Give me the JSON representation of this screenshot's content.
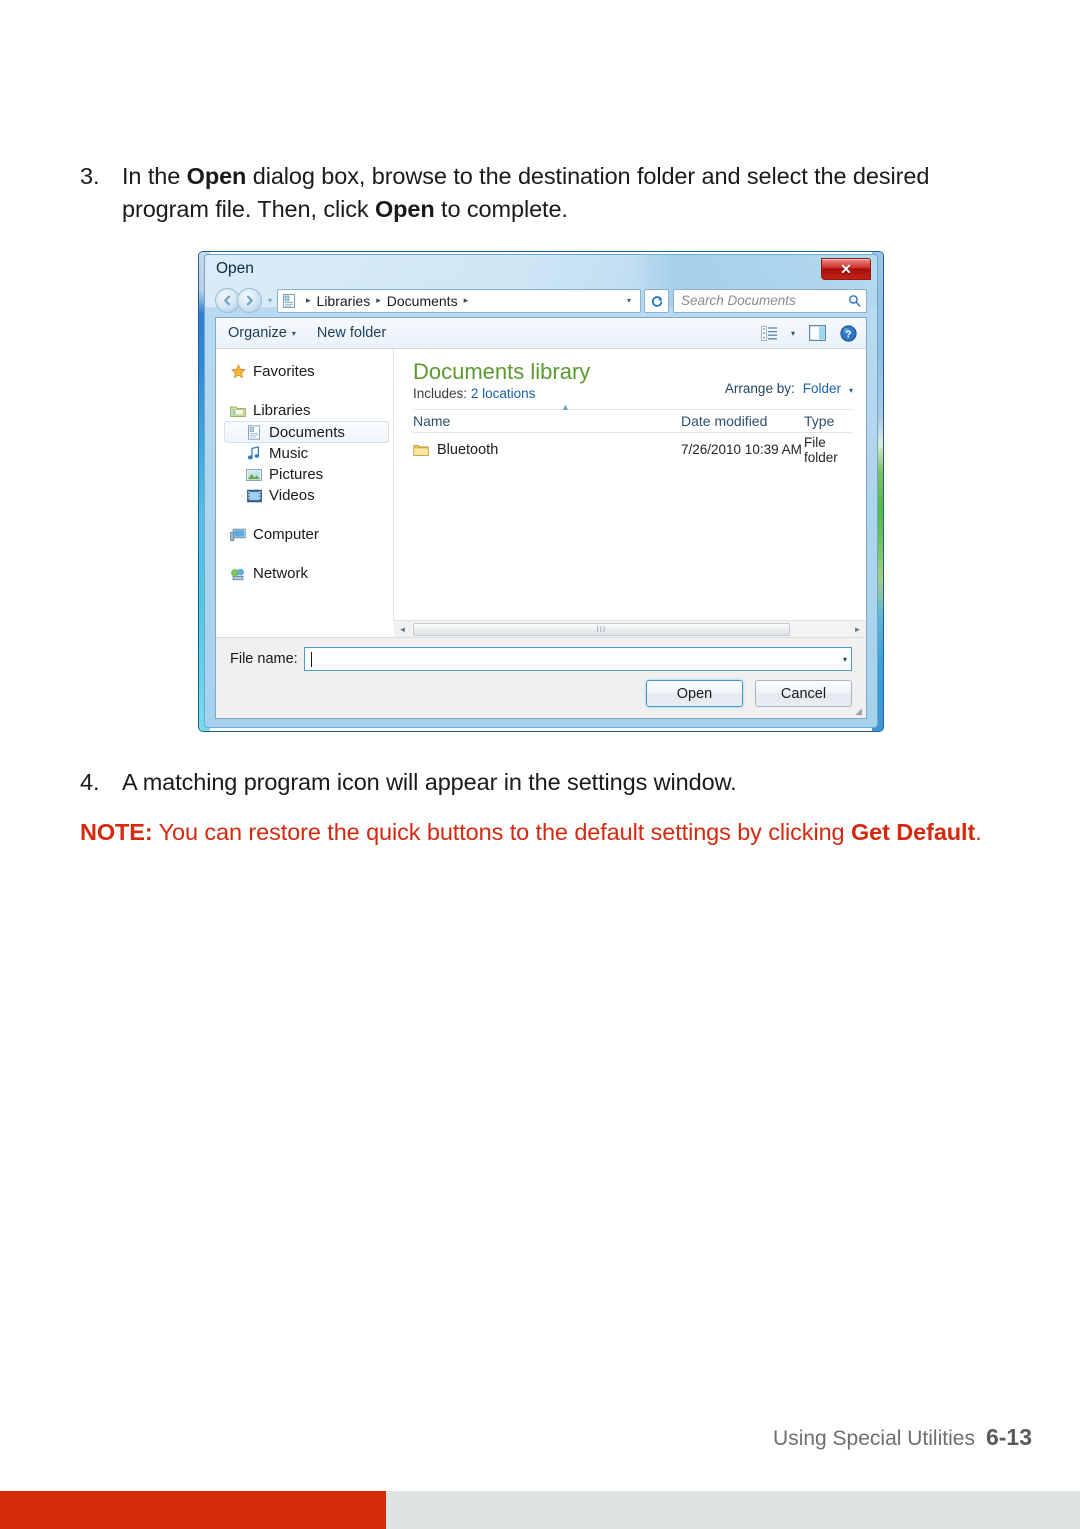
{
  "document": {
    "steps": [
      {
        "number": "3.",
        "parts": [
          {
            "text": "In the ",
            "bold": false
          },
          {
            "text": "Open",
            "bold": true
          },
          {
            "text": " dialog box, browse to the destination folder and select the desired program file. Then, click ",
            "bold": false
          },
          {
            "text": "Open",
            "bold": true
          },
          {
            "text": " to complete.",
            "bold": false
          }
        ],
        "plain": "In the Open dialog box, browse to the destination folder and select the desired program file. Then, click Open to complete."
      },
      {
        "number": "4.",
        "parts": [
          {
            "text": "A matching program icon will appear in the settings window.",
            "bold": false
          }
        ],
        "plain": "A matching program icon will appear in the settings window."
      }
    ],
    "note": {
      "label": "NOTE:",
      "text": " You can restore the quick buttons to the default settings by clicking ",
      "emphasis": "Get Default",
      "period": ".",
      "color": "#d4290f"
    },
    "footer": {
      "chapter_title": "Using Special Utilities",
      "page_number": "6-13"
    },
    "bottom_bar": {
      "accent_color": "#d42a08",
      "neutral_color": "#dde3e3"
    }
  },
  "dialog": {
    "title": "Open",
    "close_button": "✕",
    "navigation": {
      "back_icon": "back-arrow-icon",
      "forward_icon": "forward-arrow-icon",
      "history_caret": "▾",
      "address_icon": "documents-library-icon",
      "breadcrumbs": [
        "Libraries",
        "Documents"
      ],
      "breadcrumb_separator": "▸",
      "address_dropdown": "▾",
      "refresh_icon": "↻",
      "search_placeholder": "Search Documents",
      "search_icon": "search-icon"
    },
    "toolbar": {
      "organize_label": "Organize",
      "organize_caret": "▾",
      "new_folder_label": "New folder",
      "view_icon": "view-list-icon",
      "view_caret": "▾",
      "preview_pane_icon": "preview-pane-icon",
      "help_icon": "help-icon"
    },
    "nav_pane": [
      {
        "label": "Favorites",
        "icon": "star-icon",
        "indent": false,
        "selected": false,
        "gap_after": true
      },
      {
        "label": "Libraries",
        "icon": "libraries-icon",
        "indent": false,
        "selected": false,
        "gap_after": false
      },
      {
        "label": "Documents",
        "icon": "documents-icon",
        "indent": true,
        "selected": true,
        "gap_after": false
      },
      {
        "label": "Music",
        "icon": "music-icon",
        "indent": true,
        "selected": false,
        "gap_after": false
      },
      {
        "label": "Pictures",
        "icon": "pictures-icon",
        "indent": true,
        "selected": false,
        "gap_after": false
      },
      {
        "label": "Videos",
        "icon": "videos-icon",
        "indent": true,
        "selected": false,
        "gap_after": true
      },
      {
        "label": "Computer",
        "icon": "computer-icon",
        "indent": false,
        "selected": false,
        "gap_after": true
      },
      {
        "label": "Network",
        "icon": "network-icon",
        "indent": false,
        "selected": false,
        "gap_after": false
      }
    ],
    "content": {
      "library_title": "Documents library",
      "includes_label": "Includes:",
      "includes_value": "2 locations",
      "arrange_label": "Arrange by:",
      "arrange_value": "Folder",
      "arrange_caret": "▾",
      "columns": [
        "Name",
        "Date modified",
        "Type"
      ],
      "sort_indicator": "▲",
      "rows": [
        {
          "name": "Bluetooth",
          "date_modified": "7/26/2010 10:39 AM",
          "type": "File folder",
          "icon": "folder-icon"
        }
      ]
    },
    "scrollbar": {
      "left_arrow": "◄",
      "right_arrow": "►",
      "thumb_grip": "III"
    },
    "footer_controls": {
      "file_name_label": "File name:",
      "file_name_value": "",
      "file_name_dropdown": "▾",
      "open_button": "Open",
      "cancel_button": "Cancel",
      "resize_grip": "◢"
    }
  }
}
